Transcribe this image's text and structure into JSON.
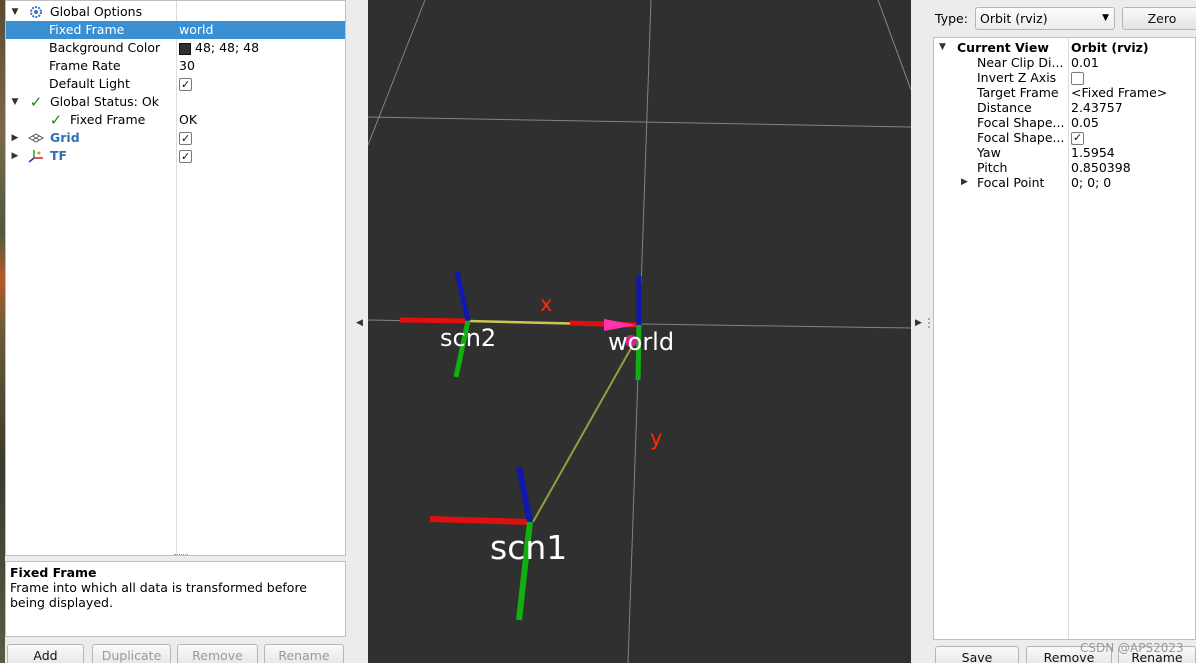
{
  "displays": {
    "rows": [
      {
        "name": "Global Options",
        "value": "",
        "icon": "gear-icon"
      },
      {
        "name": "Fixed Frame",
        "value": "world"
      },
      {
        "name": "Background Color",
        "value": "48; 48; 48",
        "swatch": "#303030"
      },
      {
        "name": "Frame Rate",
        "value": "30"
      },
      {
        "name": "Default Light",
        "value": ""
      },
      {
        "name": "Global Status: Ok",
        "value": "",
        "icon": "check-icon"
      },
      {
        "name": "Fixed Frame",
        "value": "OK",
        "icon": "check-icon"
      },
      {
        "name": "Grid",
        "value": "",
        "icon": "grid-icon"
      },
      {
        "name": "TF",
        "value": "",
        "icon": "tf-axes-icon"
      }
    ]
  },
  "description": {
    "title": "Fixed Frame",
    "text": "Frame into which all data is transformed before being displayed."
  },
  "buttons": {
    "add": "Add",
    "duplicate": "Duplicate",
    "remove": "Remove",
    "rename": "Rename"
  },
  "viewport": {
    "background": "#303030",
    "frames": [
      {
        "label": "scn2"
      },
      {
        "label": "world"
      },
      {
        "label": "scn1"
      }
    ],
    "axis_labels": {
      "x": "x",
      "y": "y"
    },
    "colors": {
      "x_axis": "#e01010",
      "y_axis": "#10b010",
      "z_axis": "#1018b0",
      "link": "#c8c850",
      "label_red": "#ff2a00"
    }
  },
  "views": {
    "type_label": "Type:",
    "type_value": "Orbit (rviz)",
    "zero_label": "Zero",
    "header": {
      "name": "Current View",
      "value": "Orbit (rviz)"
    },
    "rows": [
      {
        "name": "Near Clip Di...",
        "value": "0.01"
      },
      {
        "name": "Invert Z Axis",
        "value": ""
      },
      {
        "name": "Target Frame",
        "value": "<Fixed Frame>"
      },
      {
        "name": "Distance",
        "value": "2.43757"
      },
      {
        "name": "Focal Shape...",
        "value": "0.05"
      },
      {
        "name": "Focal Shape...",
        "value": ""
      },
      {
        "name": "Yaw",
        "value": "1.5954"
      },
      {
        "name": "Pitch",
        "value": "0.850398"
      },
      {
        "name": "Focal Point",
        "value": "0; 0; 0"
      }
    ],
    "buttons": {
      "save": "Save",
      "remove": "Remove",
      "rename": "Rename"
    }
  },
  "watermark": "CSDN @APS2023"
}
